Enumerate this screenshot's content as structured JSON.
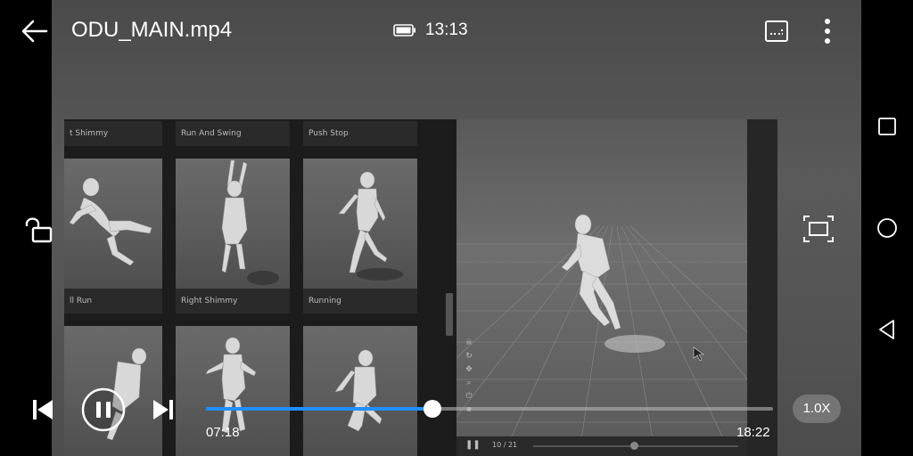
{
  "header": {
    "title": "ODU_MAIN.mp4",
    "time": "13:13"
  },
  "video": {
    "library_cards": [
      {
        "label": "t Shimmy"
      },
      {
        "label": "Run And Swing"
      },
      {
        "label": "Push Stop"
      },
      {
        "label": "ll Run"
      },
      {
        "label": "Right Shimmy"
      },
      {
        "label": "Running"
      }
    ],
    "viewport_counter": "10 / 21"
  },
  "player": {
    "elapsed": "07:18",
    "duration": "18:22",
    "progress": 0.399,
    "speed": "1.0X",
    "accent_color": "#1e90ff"
  },
  "icons": {
    "back": "arrow-left-icon",
    "battery": "battery-icon",
    "subtitles": "subtitle-icon",
    "menu": "more-vertical-icon",
    "lock": "unlock-icon",
    "fit": "fit-screen-icon",
    "prev": "skip-previous-icon",
    "pause": "pause-icon",
    "next": "skip-next-icon",
    "nav_recent": "square-icon",
    "nav_home": "circle-icon",
    "nav_back": "triangle-back-icon"
  }
}
